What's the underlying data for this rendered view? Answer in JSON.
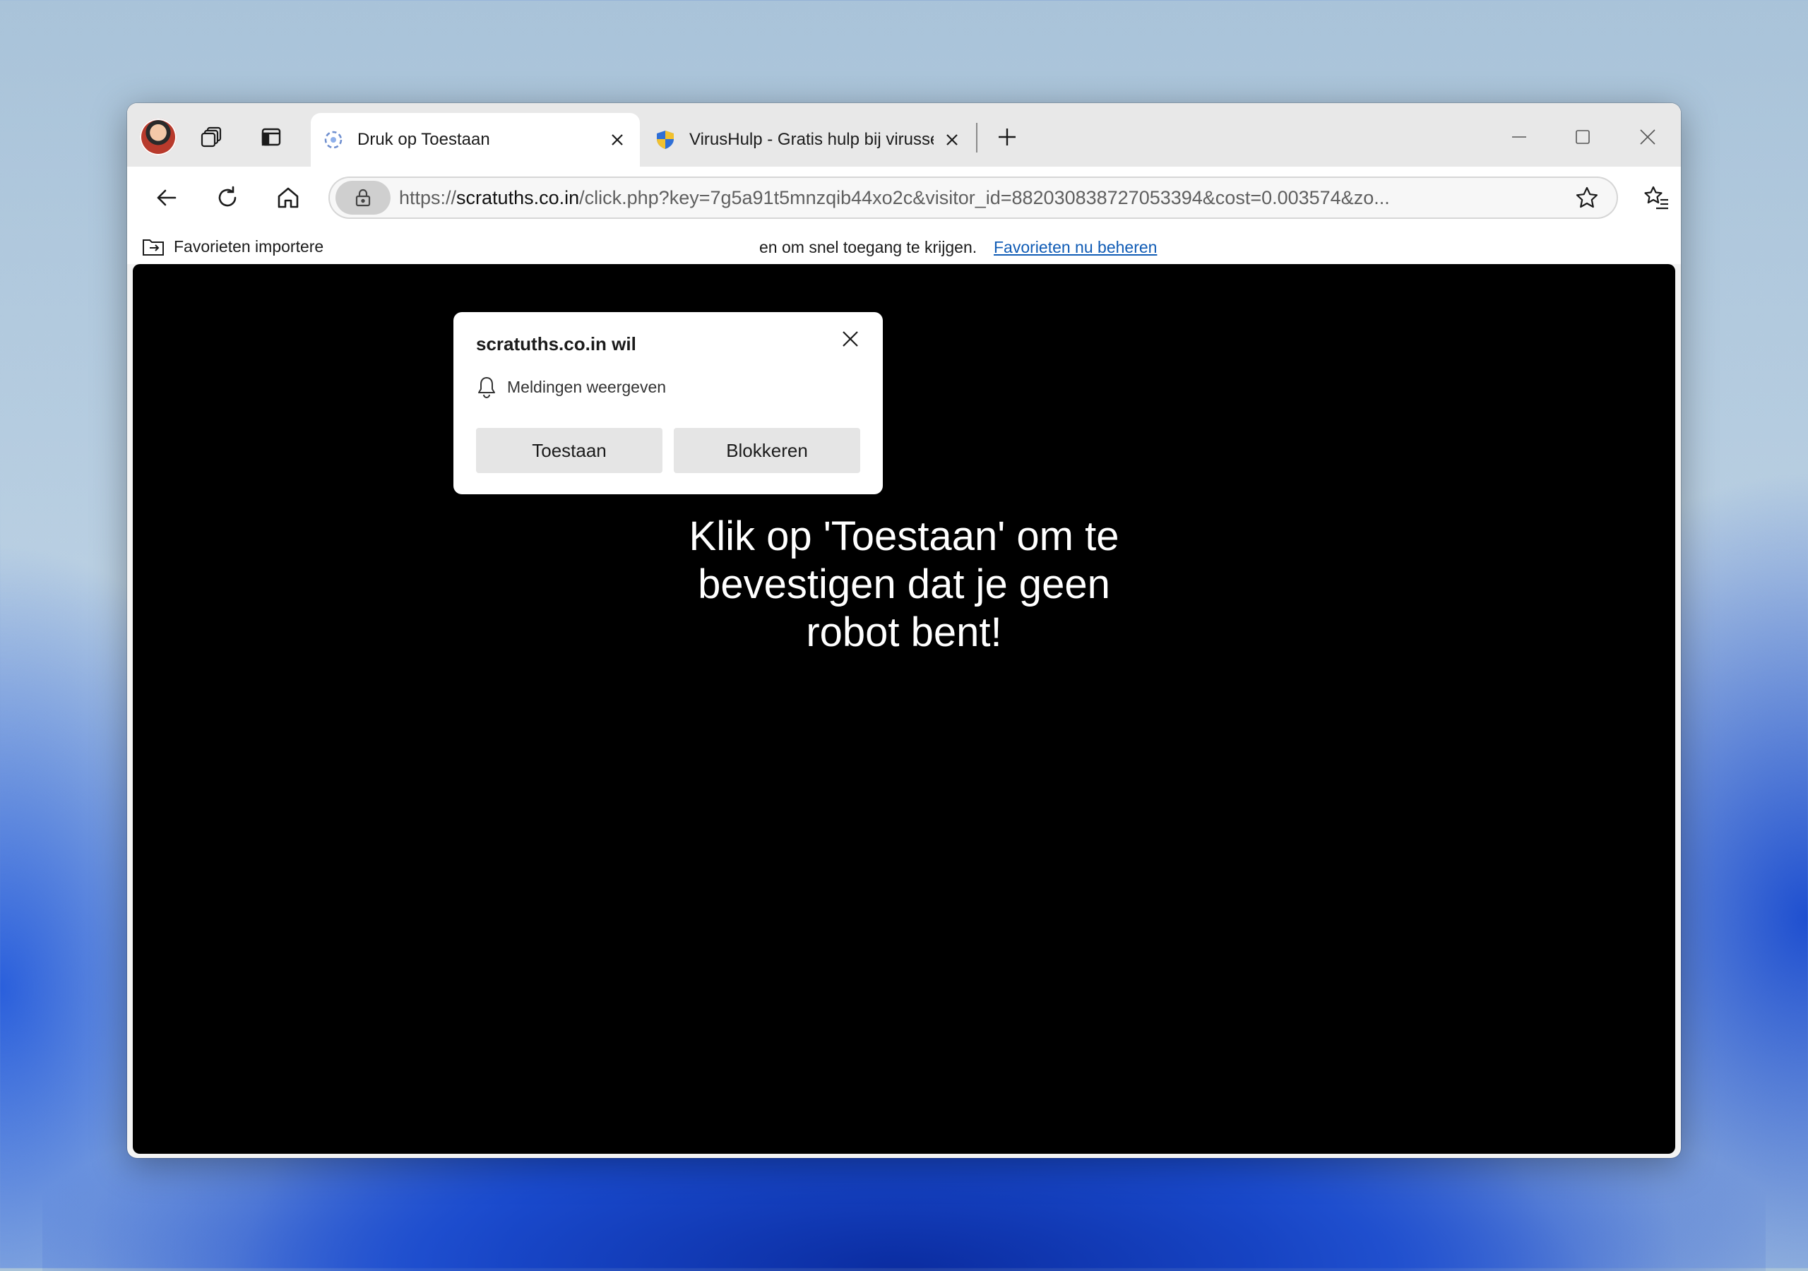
{
  "tabs": [
    {
      "title": "Druk op Toestaan",
      "active": true
    },
    {
      "title": "VirusHulp - Gratis hulp bij virussen",
      "active": false
    }
  ],
  "address": {
    "url_prefix": "https://",
    "url_host": "scratuths.co.in",
    "url_rest": "/click.php?key=7g5a91t5mnzqib44xo2c&visitor_id=882030838727053394&cost=0.003574&zo..."
  },
  "favorites_bar": {
    "import_label": "Favorieten importere",
    "hint_text": "en om snel toegang te krijgen.",
    "manage_link": "Favorieten nu beheren"
  },
  "popup": {
    "title": "scratuths.co.in wil",
    "permission": "Meldingen weergeven",
    "allow_label": "Toestaan",
    "block_label": "Blokkeren"
  },
  "page": {
    "lines": [
      "Klik op 'Toestaan' om te",
      "bevestigen dat je geen",
      "robot bent!"
    ]
  },
  "colors": {
    "accent_link": "#0f5bb5",
    "page_background": "#000000",
    "page_text": "#ffffff"
  }
}
